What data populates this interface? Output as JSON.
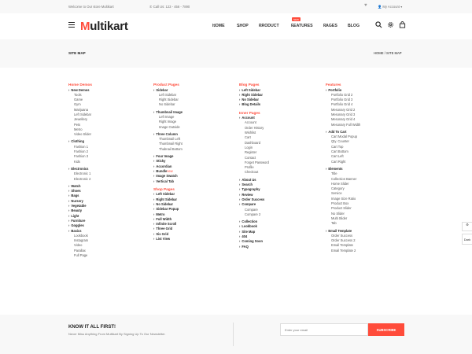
{
  "topbar": {
    "welcome": "Welcome to Our store Multikart",
    "phone": "Call Us: 123 - 456 - 7890",
    "account": "My Account"
  },
  "header": {
    "logo_m": "M",
    "logo_rest": "ultikart",
    "new_badge": "NEW",
    "nav": [
      "HOME",
      "SHOP",
      "PRODUCT",
      "FEATURES",
      "PAGES",
      "BLOG"
    ]
  },
  "breadcrumb": {
    "title": "SITE MAP",
    "path": "HOME / SITE MAP"
  },
  "columns": [
    {
      "sections": [
        {
          "title": "Home Demos",
          "items": [
            {
              "label": "New Demos",
              "sub": [
                "Tools",
                "Game",
                "Gym",
                "Marijuana",
                "Left Sidebar",
                "Jewellery",
                "Pets",
                "Metro",
                "Video Slider"
              ]
            },
            {
              "label": "Clothing",
              "sub": [
                "Fashion 1",
                "Fashion 2",
                "Fashion 3",
                "Kids"
              ]
            },
            {
              "label": "Electronics",
              "sub": [
                "Electronic 1",
                "Electronic 2"
              ]
            },
            {
              "label": "Watch",
              "sub": []
            },
            {
              "label": "Shoes",
              "sub": []
            },
            {
              "label": "Bags",
              "sub": []
            },
            {
              "label": "Nursery",
              "sub": []
            },
            {
              "label": "Vegetable",
              "sub": []
            },
            {
              "label": "Beauty",
              "sub": []
            },
            {
              "label": "Light",
              "sub": []
            },
            {
              "label": "Furniture",
              "sub": []
            },
            {
              "label": "Goggles",
              "sub": []
            },
            {
              "label": "Basics",
              "sub": [
                "Lookbook",
                "Instagram",
                "Video",
                "Parallax",
                "Full Page"
              ]
            }
          ]
        }
      ]
    },
    {
      "sections": [
        {
          "title": "Product Pages",
          "items": [
            {
              "label": "Sidebar",
              "sub": [
                "Left Sidebar",
                "Right Sidebar",
                "No Sidebar"
              ]
            },
            {
              "label": "Thumbnail Image",
              "sub": [
                "Left Image",
                "Right Image",
                "Image Outside"
              ]
            },
            {
              "label": "Three Column",
              "sub": [
                "Thumbnail Left",
                "Thumbnail Right",
                "Thubnail Bottom"
              ]
            },
            {
              "label": "Four Image",
              "sub": []
            },
            {
              "label": "Sticky",
              "sub": []
            },
            {
              "label": "Accordian",
              "sub": []
            },
            {
              "label": "Bundle",
              "badge": "new",
              "sub": []
            },
            {
              "label": "Image Swatch",
              "sub": []
            },
            {
              "label": "Vertical Tab",
              "sub": []
            }
          ]
        },
        {
          "title": "Shop Pages",
          "items": [
            {
              "label": "Left Sidebar",
              "sub": []
            },
            {
              "label": "Right Sidebar",
              "sub": []
            },
            {
              "label": "No Sidebar",
              "sub": []
            },
            {
              "label": "Sidebar Popup",
              "sub": []
            },
            {
              "label": "Metro",
              "sub": []
            },
            {
              "label": "Full Width",
              "sub": []
            },
            {
              "label": "Infinite Scroll",
              "sub": []
            },
            {
              "label": "Three Grid",
              "sub": []
            },
            {
              "label": "Six Grid",
              "sub": []
            },
            {
              "label": "List View",
              "sub": []
            }
          ]
        }
      ]
    },
    {
      "sections": [
        {
          "title": "Blog Pages",
          "items": [
            {
              "label": "Left Sidebar",
              "sub": []
            },
            {
              "label": "Right Sidebar",
              "sub": []
            },
            {
              "label": "No Sidebar",
              "sub": []
            },
            {
              "label": "Blog Details",
              "sub": []
            }
          ]
        },
        {
          "title": "Inner Pages",
          "items": [
            {
              "label": "Account",
              "sub": [
                "Account",
                "Order History",
                "Wishlist",
                "Cart",
                "Dashboard",
                "Login",
                "Register",
                "Contact",
                "Forget Password",
                "Profile",
                "Checkout"
              ]
            },
            {
              "label": "About Us",
              "sub": []
            },
            {
              "label": "Search",
              "sub": []
            },
            {
              "label": "Typography",
              "sub": []
            },
            {
              "label": "Review",
              "sub": []
            },
            {
              "label": "Order Success",
              "sub": []
            },
            {
              "label": "Compare",
              "sub": [
                "Compare",
                "Compare 2"
              ]
            },
            {
              "label": "Collection",
              "sub": []
            },
            {
              "label": "Lookbook",
              "sub": []
            },
            {
              "label": "Site Map",
              "sub": []
            },
            {
              "label": "404",
              "sub": []
            },
            {
              "label": "Coming Soon",
              "sub": []
            },
            {
              "label": "FAQ",
              "sub": []
            }
          ]
        }
      ]
    },
    {
      "sections": [
        {
          "title": "Features",
          "items": [
            {
              "label": "Portfolio",
              "sub": [
                "Portfolio Grid 2",
                "Portfolio Grid 3",
                "Portfolio Grid 4",
                "Mesonary Grid 2",
                "Mesonary Grid 3",
                "Mesonary Grid 4",
                "Mesonary Full Width"
              ]
            },
            {
              "label": "Add To Cart",
              "sub": [
                "Cart Modal Popup",
                "Qty. Counter",
                "Cart Top",
                "Cart Bottom",
                "Cart Left",
                "Cart Right"
              ]
            },
            {
              "label": "Elements",
              "sub": [
                "Title",
                "Collection Banner",
                "Home Slider",
                "Category",
                "Service",
                "Image Size Ratio",
                "Product Box",
                "Product Slider",
                "No Slider",
                "Multi Slider",
                "Tab"
              ]
            },
            {
              "label": "Email Template",
              "sub": [
                "Order Success",
                "Order Success 2",
                "Email Template",
                "Email Template 2"
              ]
            }
          ]
        }
      ]
    }
  ],
  "footer": {
    "title": "KNOW IT ALL FIRST!",
    "subtitle": "Never Miss Anything From Multikart By Signing Up To Our Newsletter.",
    "placeholder": "Enter your email",
    "button": "SUBSCRIBE"
  },
  "side_tools": {
    "dark": "Dark"
  },
  "colors": {
    "accent": "#ff4c3b"
  }
}
